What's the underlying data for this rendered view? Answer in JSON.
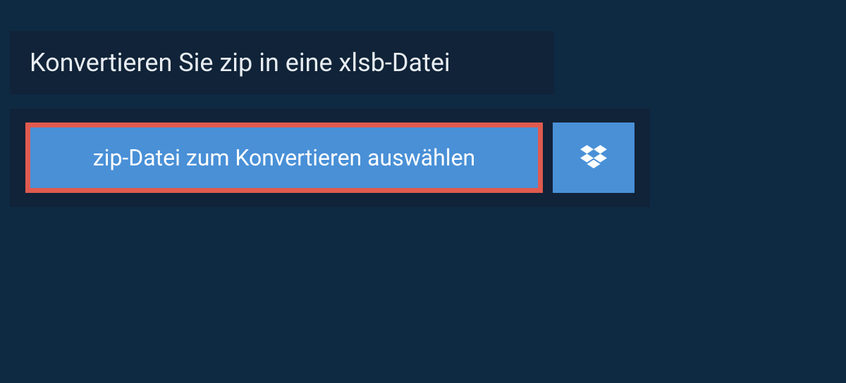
{
  "title": "Konvertieren Sie zip in eine xlsb-Datei",
  "buttons": {
    "select_file_label": "zip-Datei zum Konvertieren auswählen"
  },
  "colors": {
    "page_bg": "#0e2a42",
    "panel_bg": "#102338",
    "button_bg": "#4990d7",
    "highlight_border": "#e05a4f",
    "text_light": "#e8edf2"
  }
}
